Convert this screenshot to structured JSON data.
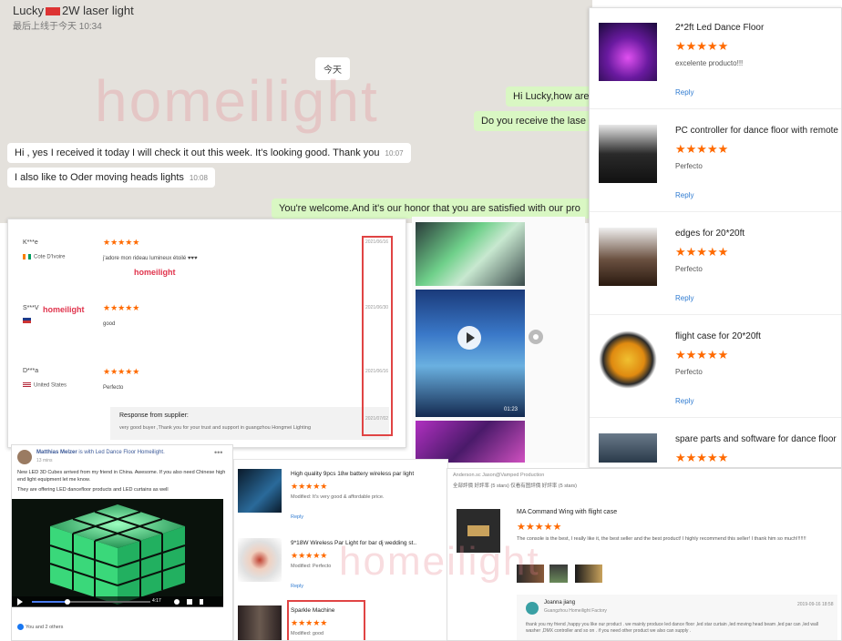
{
  "chat": {
    "title": "Lucky",
    "title_suffix": "2W laser light",
    "last_seen": "最后上线于今天 10:34",
    "day_label": "今天",
    "messages": [
      {
        "dir": "out",
        "text": "Hi Lucky,how are",
        "time": ""
      },
      {
        "dir": "out",
        "text": "Do you receive the lase",
        "time": ""
      },
      {
        "dir": "in",
        "text": "Hi , yes I received it today I will check it out this week. It's looking good. Thank you",
        "time": "10:07"
      },
      {
        "dir": "in",
        "text": "I also like to Oder moving heads lights",
        "time": "10:08"
      },
      {
        "dir": "out",
        "text": "You're welcome.And it's our honor that you are satisfied with our pro",
        "time": ""
      }
    ]
  },
  "watermark": {
    "text": "homeilight"
  },
  "reviews": {
    "brand": "homeilight",
    "items": [
      {
        "name": "K***e",
        "country": "Cote D'Ivoire",
        "flag_color": "#f77f00",
        "text": "j'adore mon rideau lumineux étoilé ♥♥♥",
        "date": "2021/06/16"
      },
      {
        "name": "S***V",
        "country": "",
        "flag_color": "#1e3a8a",
        "text": "good",
        "date": "2021/06/30"
      },
      {
        "name": "D***a",
        "country": "United States",
        "flag_color": "#b22234",
        "text": "Perfecto",
        "date": "2021/06/16"
      }
    ],
    "stars": "★★★★★",
    "supplier_title": "Response from supplier:",
    "supplier_text": "very good buyer ,Thank you for your trust and support in guangzhou Hongmei Lighting",
    "supplier_date": "2021/07/02"
  },
  "photos": {
    "video_time": "01:23"
  },
  "products": [
    {
      "title": "2*2ft Led Dance Floor",
      "text": "excelente producto!!!",
      "reply": "Reply",
      "thumb": "#5a1a8a"
    },
    {
      "title": "PC controller for dance floor with remote",
      "text": "Perfecto",
      "reply": "Reply",
      "thumb": "#3a3a3a"
    },
    {
      "title": "edges for 20*20ft",
      "text": "Perfecto",
      "reply": "Reply",
      "thumb": "#4a3a30"
    },
    {
      "title": "flight case for 20*20ft",
      "text": "Perfecto",
      "reply": "Reply",
      "thumb": "#e0a020"
    },
    {
      "title": "spare parts and software for dance floor",
      "text": "",
      "reply": "",
      "thumb": "#4a5a6a"
    }
  ],
  "product_stars": "★★★★★",
  "facebook": {
    "name": "Matthias Melzer",
    "name_suffix": "is with Led Dance Floor Homeilight.",
    "time": "13 mins",
    "text1": "New LED 3D Cubes arrived from my friend in China. Awesome. If you also need Chinese high end light equipment let me know.",
    "text2": "They are offering LED dancefloor products and LED curtains as well",
    "video_progress": 0.3,
    "video_time": "4:17",
    "likes": "You and 2 others"
  },
  "small_reviews": [
    {
      "title": "High quality 9pcs 18w battery wireless par light",
      "text": "Modified: It's very good & affordable price.",
      "reply": "Reply",
      "thumb": "#1a3a5a"
    },
    {
      "title": "9*18W Wireless Par Light for bar dj wedding st..",
      "text": "Modified: Perfecto",
      "reply": "Reply",
      "thumb": "#dcdcdc"
    },
    {
      "title": "Sparkle Machine",
      "text": "Modified: good",
      "reply": "",
      "thumb": "#3a3030"
    }
  ],
  "small_stars": "★★★★★",
  "ali": {
    "header": "Anderson.sc   Jason@Vamped Production",
    "tabs": "全部評價  好評率 (5 stars)        仅看有图評價  好評率 (5 stars)",
    "title": "MA Command Wing with flight case",
    "stars": "★★★★★",
    "text": "The console is the best, I really like it, the best seller and the best product! I highly recommend this seller! I thank him so much!!!!!!!",
    "reply_name": "Joanna jiang",
    "reply_sub": "Guangzhou Homeilight Factory",
    "reply_date": "2019-09-16 18:58",
    "reply_text": "thank you my friend ,happy you like our product . we mainly produce led dance floor ,led star curtain ,led moving head beam ,led par can ,led wall washer ,DMX controller and so on . if you need other product we also can supply ."
  }
}
